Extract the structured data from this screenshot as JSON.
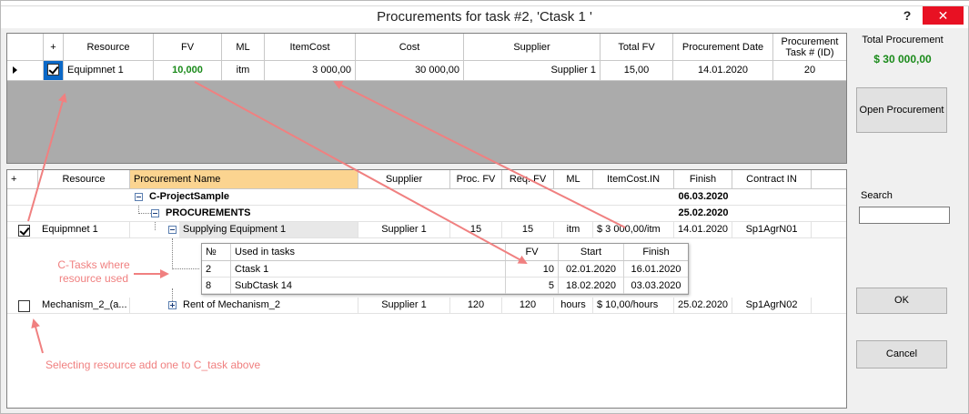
{
  "window": {
    "title": "Procurements for task #2, 'Ctask 1 '",
    "help_label": "?",
    "close_label": "✕"
  },
  "top_grid": {
    "headers": {
      "plus": "+",
      "resource": "Resource",
      "fv": "FV",
      "ml": "ML",
      "item_cost": "ItemCost",
      "cost": "Cost",
      "supplier": "Supplier",
      "total_fv": "Total FV",
      "proc_date": "Procurement Date",
      "proc_task": "Procurement Task # (ID)"
    },
    "rows": [
      {
        "checked": true,
        "resource": "Equipmnet 1",
        "fv": "10,000",
        "ml": "itm",
        "item_cost": "3 000,00",
        "cost": "30 000,00",
        "supplier": "Supplier 1",
        "total_fv": "15,00",
        "proc_date": "14.01.2020",
        "proc_task": "20"
      }
    ]
  },
  "right_panel": {
    "total_label": "Total Procurement",
    "total_value": "$ 30  000,00",
    "open_button": "Open Procurement",
    "search_label": "Search",
    "search_value": "",
    "ok_button": "OK",
    "cancel_button": "Cancel"
  },
  "tree_grid": {
    "headers": {
      "plus": "+",
      "resource": "Resource",
      "proc_name": "Procurement Name",
      "supplier": "Supplier",
      "proc_fv": "Proc. FV",
      "req_fv": "Req. FV",
      "ml": "ML",
      "item_cost_in": "ItemCost.IN",
      "finish": "Finish",
      "contract_in": "Contract IN"
    },
    "rows": [
      {
        "resource": "",
        "name": "C-ProjectSample",
        "supplier": "",
        "proc_fv": "",
        "req_fv": "",
        "ml": "",
        "item_cost": "",
        "finish": "06.03.2020",
        "contract": ""
      },
      {
        "resource": "",
        "name": "PROCUREMENTS",
        "supplier": "",
        "proc_fv": "",
        "req_fv": "",
        "ml": "",
        "item_cost": "",
        "finish": "25.02.2020",
        "contract": ""
      },
      {
        "checked": true,
        "resource": "Equipmnet 1",
        "name": "Supplying Equipment 1",
        "supplier": "Supplier 1",
        "proc_fv": "15",
        "req_fv": "15",
        "ml": "itm",
        "item_cost": "$ 3 000,00/itm",
        "finish": "14.01.2020",
        "contract": "Sp1AgrN01"
      },
      {
        "checked": false,
        "resource": "Mechanism_2_(a...",
        "name": "Rent of Mechanism_2",
        "supplier": "Supplier 1",
        "proc_fv": "120",
        "req_fv": "120",
        "ml": "hours",
        "item_cost": "$ 10,00/hours",
        "finish": "25.02.2020",
        "contract": "Sp1AgrN02"
      }
    ]
  },
  "used_tasks": {
    "headers": {
      "no": "№",
      "used_in": "Used in tasks",
      "fv": "FV",
      "start": "Start",
      "finish": "Finish"
    },
    "rows": [
      {
        "no": "2",
        "task": "Ctask 1",
        "fv": "10",
        "start": "02.01.2020",
        "finish": "16.01.2020"
      },
      {
        "no": "8",
        "task": "SubCtask 14",
        "fv": "5",
        "start": "18.02.2020",
        "finish": "03.03.2020"
      }
    ]
  },
  "annotations": {
    "ctasks_note": "C-Tasks where resource used",
    "selecting_note": "Selecting resource add one to C_task above",
    "color": "#f08080"
  }
}
